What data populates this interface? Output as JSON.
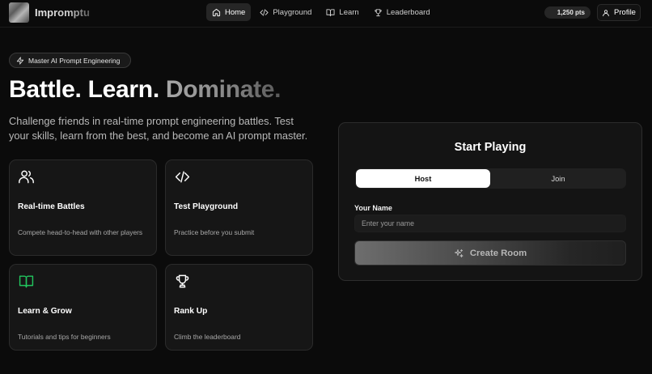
{
  "brand": {
    "name": "Impromptu"
  },
  "nav": {
    "links": [
      {
        "label": "Home",
        "icon": "home-icon",
        "active": true
      },
      {
        "label": "Playground",
        "icon": "code-icon",
        "active": false
      },
      {
        "label": "Learn",
        "icon": "book-icon",
        "active": false
      },
      {
        "label": "Leaderboard",
        "icon": "trophy-icon",
        "active": false
      }
    ],
    "points": "1,250 pts",
    "profile_label": "Profile"
  },
  "hero": {
    "badge": "Master AI Prompt Engineering",
    "headline_solid": "Battle. Learn. ",
    "headline_fade": "Dominate.",
    "subtext": "Challenge friends in real-time prompt engineering battles. Test your skills, learn from the best, and become an AI prompt master."
  },
  "features": [
    {
      "title": "Real-time Battles",
      "desc": "Compete head-to-head with other players",
      "icon": "users-icon"
    },
    {
      "title": "Test Playground",
      "desc": "Practice before you submit",
      "icon": "code-icon"
    },
    {
      "title": "Learn & Grow",
      "desc": "Tutorials and tips for beginners",
      "icon": "book-open-icon"
    },
    {
      "title": "Rank Up",
      "desc": "Climb the leaderboard",
      "icon": "trophy-icon"
    }
  ],
  "start": {
    "title": "Start Playing",
    "tabs": [
      "Host",
      "Join"
    ],
    "selected_tab": "Host",
    "name_label": "Your Name",
    "name_placeholder": "Enter your name",
    "name_value": "",
    "create_label": "Create Room"
  },
  "colors": {
    "background": "#0b0b0b",
    "card": "#161616",
    "accent_green": "#22c55e"
  }
}
